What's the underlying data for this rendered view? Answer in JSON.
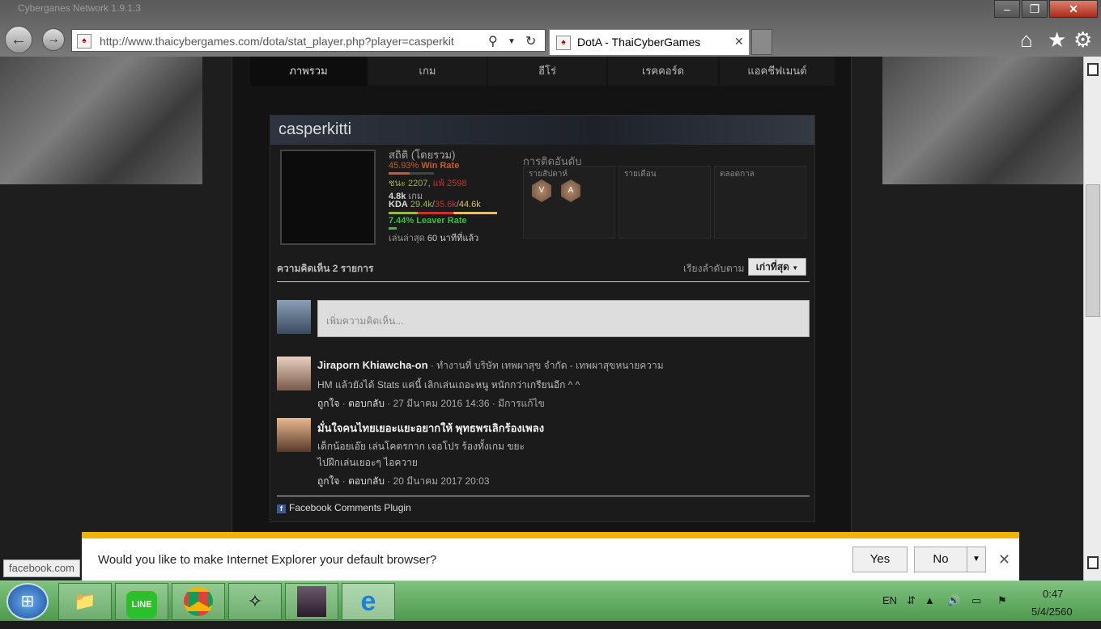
{
  "window": {
    "title": "Cyberganes Network 1.9.1.3"
  },
  "browser": {
    "url": "http://www.thaicybergames.com/dota/stat_player.php?player=casperkit",
    "tab_title": "DotA - ThaiCyberGames"
  },
  "site_nav": {
    "tabs": [
      "ภาพรวม",
      "เกม",
      "ฮีโร่",
      "เรคคอร์ด",
      "แอคชีฟเมนต์"
    ]
  },
  "profile": {
    "player_name": "casperkitti",
    "stats_title": "สถิติ (โดยรวม)",
    "win_rate_value": "45.93%",
    "win_rate_label": "Win Rate",
    "wins_label": "ชนะ",
    "wins": "2207",
    "losses_label": "แพ้",
    "losses": "2598",
    "games_value": "4.8k",
    "games_label": "เกม",
    "kda_label": "KDA",
    "kills": "29.4k",
    "deaths": "35.6k",
    "assists": "44.6k",
    "leaver_rate": "7.44% Leaver Rate",
    "last_played_label": "เล่นล่าสุด",
    "last_played_value": "60 นาทีที่แล้ว",
    "win_fraction": 0.4593,
    "leaver_fraction": 0.0744,
    "ranking": {
      "title": "การติดอันดับ",
      "weekly": "รายสัปดาห์",
      "monthly": "รายเดือน",
      "alltime": "ตลอดกาล",
      "medals": [
        "V",
        "A"
      ]
    }
  },
  "comments": {
    "header": "ความคิดเห็น 2 รายการ",
    "sort_label": "เรียงลำดับตาม",
    "sort_value": "เก่าที่สุด",
    "input_placeholder": "เพิ่มความคิดเห็น...",
    "items": [
      {
        "name": "Jiraporn Khiawcha-on",
        "meta": " · ทำงานที่ บริษัท เทพผาสุข จำกัด - เทพผาสุขหนายความ",
        "lines": [
          "HM แล้วยังได้ Stats แค่นี้ เลิกเล่นเถอะหนู หนักกว่าเกรียนอีก ^ ^"
        ],
        "like": "ถูกใจ",
        "reply": "ตอบกลับ",
        "date": "27 มีนาคม 2016 14:36",
        "edited": "มีการแก้ไข"
      },
      {
        "name": "มั่นใจคนไทยเยอะแยะอยากให้ พุทธพรเลิกร้องเพลง",
        "meta": "",
        "lines": [
          "เด็กน้อยเอ๊ย เล่นโคตรกาก เจอโปร ร้องทั้งเกม ขยะ",
          "ไปฝึกเล่นเยอะๆ ไอควาย"
        ],
        "like": "ถูกใจ",
        "reply": "ตอบกลับ",
        "date": "20 มีนาคม 2017 20:03",
        "edited": ""
      }
    ],
    "plugin_label": "Facebook Comments Plugin"
  },
  "notification": {
    "message": "Would you like to make Internet Explorer your default browser?",
    "yes": "Yes",
    "no": "No"
  },
  "status_url": "facebook.com",
  "taskbar": {
    "lang": "EN",
    "time": "0:47",
    "date": "5/4/2560",
    "apps": [
      "file-explorer",
      "line",
      "chrome",
      "game-launcher",
      "warcraft",
      "internet-explorer"
    ]
  }
}
